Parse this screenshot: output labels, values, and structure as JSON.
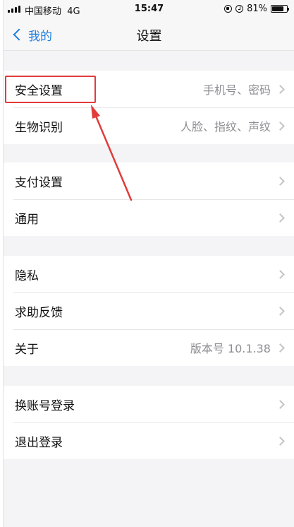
{
  "status_bar": {
    "carrier": "中国移动",
    "network": "4G",
    "time": "15:47",
    "battery_percent": "81%",
    "battery_level": 0.81
  },
  "nav": {
    "back_label": "我的",
    "title": "设置"
  },
  "groups": [
    {
      "items": [
        {
          "label": "安全设置",
          "value": "手机号、密码"
        },
        {
          "label": "生物识别",
          "value": "人脸、指纹、声纹"
        }
      ]
    },
    {
      "items": [
        {
          "label": "支付设置",
          "value": ""
        },
        {
          "label": "通用",
          "value": ""
        }
      ]
    },
    {
      "items": [
        {
          "label": "隐私",
          "value": ""
        },
        {
          "label": "求助反馈",
          "value": ""
        },
        {
          "label": "关于",
          "value": "版本号 10.1.38"
        }
      ]
    },
    {
      "items": [
        {
          "label": "换账号登录",
          "value": ""
        },
        {
          "label": "退出登录",
          "value": ""
        }
      ]
    }
  ],
  "colors": {
    "accent": "#1f7ce0",
    "annotation": "#e23b3b",
    "background": "#f4f4f6"
  }
}
